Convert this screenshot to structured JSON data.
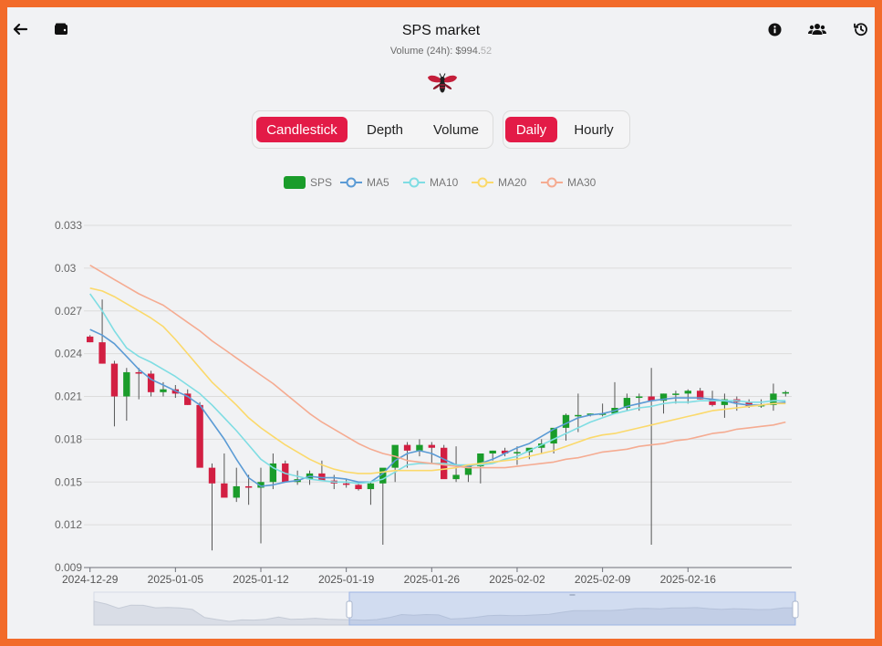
{
  "header": {
    "title": "SPS market",
    "volume_label": "Volume (24h): $994.",
    "volume_cents": "52",
    "back_icon": "arrow-left-icon",
    "wallet_icon": "wallet-icon",
    "info_icon": "info-icon",
    "users_icon": "users-icon",
    "history_icon": "history-icon"
  },
  "chart_type_tabs": [
    {
      "label": "Candlestick",
      "active": true
    },
    {
      "label": "Depth",
      "active": false
    },
    {
      "label": "Volume",
      "active": false
    }
  ],
  "interval_tabs": [
    {
      "label": "Daily",
      "active": true
    },
    {
      "label": "Hourly",
      "active": false
    }
  ],
  "legend": [
    {
      "label": "SPS",
      "color": "#1a9c2a"
    },
    {
      "label": "MA5",
      "color": "#5b9bd5"
    },
    {
      "label": "MA10",
      "color": "#7fdde3"
    },
    {
      "label": "MA20",
      "color": "#fbd96b"
    },
    {
      "label": "MA30",
      "color": "#f5ab91"
    }
  ],
  "colors": {
    "up": "#1a9c2a",
    "down": "#d21f42",
    "accent": "#e31b47"
  },
  "chart_data": {
    "type": "candlestick",
    "series_name": "SPS",
    "ylim": [
      0.009,
      0.033
    ],
    "yticks": [
      "0.033",
      "0.03",
      "0.027",
      "0.024",
      "0.021",
      "0.018",
      "0.015",
      "0.012",
      "0.009"
    ],
    "xtick_labels": [
      "2024-12-29",
      "2025-01-05",
      "2025-01-12",
      "2025-01-19",
      "2025-01-26",
      "2025-02-02",
      "2025-02-09",
      "2025-02-16"
    ],
    "x": [
      "2024-12-29",
      "2024-12-30",
      "2024-12-31",
      "2025-01-01",
      "2025-01-02",
      "2025-01-03",
      "2025-01-04",
      "2025-01-05",
      "2025-01-06",
      "2025-01-07",
      "2025-01-08",
      "2025-01-09",
      "2025-01-10",
      "2025-01-11",
      "2025-01-12",
      "2025-01-13",
      "2025-01-14",
      "2025-01-15",
      "2025-01-16",
      "2025-01-17",
      "2025-01-18",
      "2025-01-19",
      "2025-01-20",
      "2025-01-21",
      "2025-01-22",
      "2025-01-23",
      "2025-01-24",
      "2025-01-25",
      "2025-01-26",
      "2025-01-27",
      "2025-01-28",
      "2025-01-29",
      "2025-01-30",
      "2025-01-31",
      "2025-02-01",
      "2025-02-02",
      "2025-02-03",
      "2025-02-04",
      "2025-02-05",
      "2025-02-06",
      "2025-02-07",
      "2025-02-08",
      "2025-02-09",
      "2025-02-10",
      "2025-02-11",
      "2025-02-12",
      "2025-02-13",
      "2025-02-14",
      "2025-02-15",
      "2025-02-16",
      "2025-02-17",
      "2025-02-18",
      "2025-02-19",
      "2025-02-20",
      "2025-02-21",
      "2025-02-22",
      "2025-02-23",
      "2025-02-24"
    ],
    "open": [
      0.0252,
      0.0248,
      0.0233,
      0.021,
      0.0227,
      0.0226,
      0.0213,
      0.0215,
      0.0212,
      0.0204,
      0.016,
      0.0149,
      0.0139,
      0.0147,
      0.0146,
      0.015,
      0.0163,
      0.015,
      0.0152,
      0.0156,
      0.0151,
      0.0149,
      0.0148,
      0.0145,
      0.0149,
      0.016,
      0.0176,
      0.0172,
      0.0176,
      0.0174,
      0.0152,
      0.0155,
      0.0161,
      0.017,
      0.0172,
      0.017,
      0.0171,
      0.0174,
      0.0177,
      0.0188,
      0.0197,
      0.0197,
      0.0198,
      0.0198,
      0.0202,
      0.0209,
      0.021,
      0.0207,
      0.0212,
      0.0212,
      0.0214,
      0.0208,
      0.0204,
      0.0208,
      0.0206,
      0.0203,
      0.0204,
      0.0212
    ],
    "high": [
      0.0253,
      0.0278,
      0.0235,
      0.023,
      0.023,
      0.0228,
      0.022,
      0.0218,
      0.0215,
      0.0206,
      0.0163,
      0.017,
      0.016,
      0.0155,
      0.016,
      0.017,
      0.0165,
      0.0158,
      0.0158,
      0.0165,
      0.0155,
      0.0152,
      0.015,
      0.015,
      0.0156,
      0.0163,
      0.0178,
      0.018,
      0.0178,
      0.0176,
      0.0175,
      0.016,
      0.0165,
      0.0172,
      0.0174,
      0.0175,
      0.0172,
      0.018,
      0.018,
      0.0198,
      0.0212,
      0.0198,
      0.0205,
      0.022,
      0.0212,
      0.0212,
      0.023,
      0.0212,
      0.0214,
      0.0215,
      0.0216,
      0.0214,
      0.0212,
      0.021,
      0.0208,
      0.0208,
      0.0219,
      0.0214
    ],
    "low": [
      0.0248,
      0.0233,
      0.0189,
      0.0193,
      0.0208,
      0.021,
      0.021,
      0.0209,
      0.0204,
      0.02,
      0.0102,
      0.014,
      0.0136,
      0.0134,
      0.0107,
      0.0145,
      0.015,
      0.0148,
      0.0148,
      0.0153,
      0.0145,
      0.0146,
      0.0144,
      0.0134,
      0.0106,
      0.015,
      0.016,
      0.0168,
      0.0163,
      0.0165,
      0.015,
      0.015,
      0.0149,
      0.0165,
      0.0168,
      0.0162,
      0.0166,
      0.017,
      0.017,
      0.0179,
      0.0185,
      0.0196,
      0.0196,
      0.0198,
      0.02,
      0.02,
      0.0106,
      0.0198,
      0.0205,
      0.0205,
      0.0208,
      0.0203,
      0.0195,
      0.02,
      0.0202,
      0.0202,
      0.02,
      0.021
    ],
    "close": [
      0.0248,
      0.0233,
      0.021,
      0.0227,
      0.0226,
      0.0213,
      0.0215,
      0.0212,
      0.0204,
      0.016,
      0.0149,
      0.0139,
      0.0147,
      0.0146,
      0.015,
      0.0163,
      0.015,
      0.0152,
      0.0156,
      0.0151,
      0.0149,
      0.0148,
      0.0145,
      0.0149,
      0.016,
      0.0176,
      0.0172,
      0.0176,
      0.0174,
      0.0152,
      0.0155,
      0.0161,
      0.017,
      0.0172,
      0.017,
      0.0171,
      0.0174,
      0.0177,
      0.0188,
      0.0197,
      0.0197,
      0.0198,
      0.0198,
      0.0202,
      0.0209,
      0.021,
      0.0207,
      0.0212,
      0.0212,
      0.0214,
      0.0208,
      0.0204,
      0.0208,
      0.0206,
      0.0203,
      0.0204,
      0.0212,
      0.0213
    ],
    "ma5": [
      0.0257,
      0.0253,
      0.0247,
      0.0238,
      0.0229,
      0.0222,
      0.0218,
      0.0214,
      0.021,
      0.0204,
      0.0192,
      0.018,
      0.0166,
      0.0153,
      0.0147,
      0.0148,
      0.015,
      0.0151,
      0.0154,
      0.0153,
      0.0153,
      0.0152,
      0.015,
      0.015,
      0.0156,
      0.0165,
      0.017,
      0.0172,
      0.017,
      0.0166,
      0.0162,
      0.0161,
      0.0163,
      0.0166,
      0.017,
      0.0174,
      0.0177,
      0.0182,
      0.0187,
      0.0191,
      0.0195,
      0.0197,
      0.0198,
      0.02,
      0.0203,
      0.0205,
      0.0207,
      0.0208,
      0.0209,
      0.0209,
      0.0209,
      0.0208,
      0.0207,
      0.0205,
      0.0204,
      0.0204,
      0.0205,
      0.0206
    ],
    "ma10": [
      0.0282,
      0.027,
      0.0256,
      0.0244,
      0.0238,
      0.0234,
      0.0229,
      0.0224,
      0.0218,
      0.0212,
      0.0204,
      0.0195,
      0.0186,
      0.0176,
      0.0166,
      0.016,
      0.0156,
      0.0154,
      0.0152,
      0.0151,
      0.015,
      0.015,
      0.0149,
      0.015,
      0.0152,
      0.0157,
      0.0162,
      0.0163,
      0.0163,
      0.0163,
      0.0162,
      0.0162,
      0.0162,
      0.0163,
      0.0166,
      0.0168,
      0.0172,
      0.0176,
      0.018,
      0.0184,
      0.0188,
      0.0192,
      0.0195,
      0.0198,
      0.02,
      0.0202,
      0.0203,
      0.0205,
      0.0206,
      0.0206,
      0.0207,
      0.0207,
      0.0207,
      0.0207,
      0.0206,
      0.0206,
      0.0207,
      0.0207
    ],
    "ma20": [
      0.0286,
      0.0284,
      0.028,
      0.0275,
      0.027,
      0.0265,
      0.0259,
      0.025,
      0.024,
      0.023,
      0.022,
      0.0212,
      0.0204,
      0.0195,
      0.0188,
      0.0182,
      0.0176,
      0.0171,
      0.0166,
      0.0162,
      0.0159,
      0.0157,
      0.0156,
      0.0156,
      0.0157,
      0.0158,
      0.0158,
      0.0158,
      0.0158,
      0.0159,
      0.016,
      0.0162,
      0.0163,
      0.0164,
      0.0165,
      0.0166,
      0.0168,
      0.017,
      0.0172,
      0.0175,
      0.0178,
      0.0181,
      0.0183,
      0.0184,
      0.0186,
      0.0188,
      0.019,
      0.0192,
      0.0194,
      0.0196,
      0.0198,
      0.02,
      0.0201,
      0.0202,
      0.0203,
      0.0204,
      0.0205,
      0.0205
    ],
    "ma30": [
      0.0302,
      0.0297,
      0.0292,
      0.0287,
      0.0282,
      0.0278,
      0.0274,
      0.0268,
      0.0262,
      0.0256,
      0.0249,
      0.0243,
      0.0237,
      0.0231,
      0.0225,
      0.0219,
      0.0212,
      0.0205,
      0.0198,
      0.0192,
      0.0187,
      0.0182,
      0.0177,
      0.0173,
      0.017,
      0.0168,
      0.0165,
      0.0164,
      0.0163,
      0.0162,
      0.0161,
      0.016,
      0.016,
      0.016,
      0.016,
      0.0161,
      0.0162,
      0.0163,
      0.0164,
      0.0166,
      0.0167,
      0.0169,
      0.0171,
      0.0172,
      0.0173,
      0.0175,
      0.0176,
      0.0177,
      0.0179,
      0.018,
      0.0182,
      0.0184,
      0.0185,
      0.0187,
      0.0188,
      0.0189,
      0.019,
      0.0192
    ]
  }
}
